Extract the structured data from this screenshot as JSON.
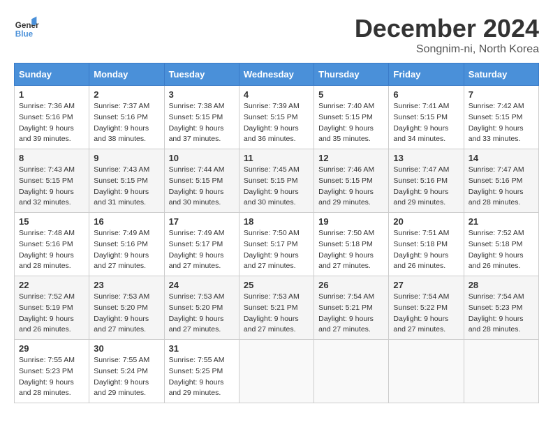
{
  "header": {
    "logo_line1": "General",
    "logo_line2": "Blue",
    "month_title": "December 2024",
    "location": "Songnim-ni, North Korea"
  },
  "weekdays": [
    "Sunday",
    "Monday",
    "Tuesday",
    "Wednesday",
    "Thursday",
    "Friday",
    "Saturday"
  ],
  "weeks": [
    [
      {
        "day": "1",
        "sunrise": "Sunrise: 7:36 AM",
        "sunset": "Sunset: 5:16 PM",
        "daylight": "Daylight: 9 hours and 39 minutes."
      },
      {
        "day": "2",
        "sunrise": "Sunrise: 7:37 AM",
        "sunset": "Sunset: 5:16 PM",
        "daylight": "Daylight: 9 hours and 38 minutes."
      },
      {
        "day": "3",
        "sunrise": "Sunrise: 7:38 AM",
        "sunset": "Sunset: 5:15 PM",
        "daylight": "Daylight: 9 hours and 37 minutes."
      },
      {
        "day": "4",
        "sunrise": "Sunrise: 7:39 AM",
        "sunset": "Sunset: 5:15 PM",
        "daylight": "Daylight: 9 hours and 36 minutes."
      },
      {
        "day": "5",
        "sunrise": "Sunrise: 7:40 AM",
        "sunset": "Sunset: 5:15 PM",
        "daylight": "Daylight: 9 hours and 35 minutes."
      },
      {
        "day": "6",
        "sunrise": "Sunrise: 7:41 AM",
        "sunset": "Sunset: 5:15 PM",
        "daylight": "Daylight: 9 hours and 34 minutes."
      },
      {
        "day": "7",
        "sunrise": "Sunrise: 7:42 AM",
        "sunset": "Sunset: 5:15 PM",
        "daylight": "Daylight: 9 hours and 33 minutes."
      }
    ],
    [
      {
        "day": "8",
        "sunrise": "Sunrise: 7:43 AM",
        "sunset": "Sunset: 5:15 PM",
        "daylight": "Daylight: 9 hours and 32 minutes."
      },
      {
        "day": "9",
        "sunrise": "Sunrise: 7:43 AM",
        "sunset": "Sunset: 5:15 PM",
        "daylight": "Daylight: 9 hours and 31 minutes."
      },
      {
        "day": "10",
        "sunrise": "Sunrise: 7:44 AM",
        "sunset": "Sunset: 5:15 PM",
        "daylight": "Daylight: 9 hours and 30 minutes."
      },
      {
        "day": "11",
        "sunrise": "Sunrise: 7:45 AM",
        "sunset": "Sunset: 5:15 PM",
        "daylight": "Daylight: 9 hours and 30 minutes."
      },
      {
        "day": "12",
        "sunrise": "Sunrise: 7:46 AM",
        "sunset": "Sunset: 5:15 PM",
        "daylight": "Daylight: 9 hours and 29 minutes."
      },
      {
        "day": "13",
        "sunrise": "Sunrise: 7:47 AM",
        "sunset": "Sunset: 5:16 PM",
        "daylight": "Daylight: 9 hours and 29 minutes."
      },
      {
        "day": "14",
        "sunrise": "Sunrise: 7:47 AM",
        "sunset": "Sunset: 5:16 PM",
        "daylight": "Daylight: 9 hours and 28 minutes."
      }
    ],
    [
      {
        "day": "15",
        "sunrise": "Sunrise: 7:48 AM",
        "sunset": "Sunset: 5:16 PM",
        "daylight": "Daylight: 9 hours and 28 minutes."
      },
      {
        "day": "16",
        "sunrise": "Sunrise: 7:49 AM",
        "sunset": "Sunset: 5:16 PM",
        "daylight": "Daylight: 9 hours and 27 minutes."
      },
      {
        "day": "17",
        "sunrise": "Sunrise: 7:49 AM",
        "sunset": "Sunset: 5:17 PM",
        "daylight": "Daylight: 9 hours and 27 minutes."
      },
      {
        "day": "18",
        "sunrise": "Sunrise: 7:50 AM",
        "sunset": "Sunset: 5:17 PM",
        "daylight": "Daylight: 9 hours and 27 minutes."
      },
      {
        "day": "19",
        "sunrise": "Sunrise: 7:50 AM",
        "sunset": "Sunset: 5:18 PM",
        "daylight": "Daylight: 9 hours and 27 minutes."
      },
      {
        "day": "20",
        "sunrise": "Sunrise: 7:51 AM",
        "sunset": "Sunset: 5:18 PM",
        "daylight": "Daylight: 9 hours and 26 minutes."
      },
      {
        "day": "21",
        "sunrise": "Sunrise: 7:52 AM",
        "sunset": "Sunset: 5:18 PM",
        "daylight": "Daylight: 9 hours and 26 minutes."
      }
    ],
    [
      {
        "day": "22",
        "sunrise": "Sunrise: 7:52 AM",
        "sunset": "Sunset: 5:19 PM",
        "daylight": "Daylight: 9 hours and 26 minutes."
      },
      {
        "day": "23",
        "sunrise": "Sunrise: 7:53 AM",
        "sunset": "Sunset: 5:20 PM",
        "daylight": "Daylight: 9 hours and 27 minutes."
      },
      {
        "day": "24",
        "sunrise": "Sunrise: 7:53 AM",
        "sunset": "Sunset: 5:20 PM",
        "daylight": "Daylight: 9 hours and 27 minutes."
      },
      {
        "day": "25",
        "sunrise": "Sunrise: 7:53 AM",
        "sunset": "Sunset: 5:21 PM",
        "daylight": "Daylight: 9 hours and 27 minutes."
      },
      {
        "day": "26",
        "sunrise": "Sunrise: 7:54 AM",
        "sunset": "Sunset: 5:21 PM",
        "daylight": "Daylight: 9 hours and 27 minutes."
      },
      {
        "day": "27",
        "sunrise": "Sunrise: 7:54 AM",
        "sunset": "Sunset: 5:22 PM",
        "daylight": "Daylight: 9 hours and 27 minutes."
      },
      {
        "day": "28",
        "sunrise": "Sunrise: 7:54 AM",
        "sunset": "Sunset: 5:23 PM",
        "daylight": "Daylight: 9 hours and 28 minutes."
      }
    ],
    [
      {
        "day": "29",
        "sunrise": "Sunrise: 7:55 AM",
        "sunset": "Sunset: 5:23 PM",
        "daylight": "Daylight: 9 hours and 28 minutes."
      },
      {
        "day": "30",
        "sunrise": "Sunrise: 7:55 AM",
        "sunset": "Sunset: 5:24 PM",
        "daylight": "Daylight: 9 hours and 29 minutes."
      },
      {
        "day": "31",
        "sunrise": "Sunrise: 7:55 AM",
        "sunset": "Sunset: 5:25 PM",
        "daylight": "Daylight: 9 hours and 29 minutes."
      },
      null,
      null,
      null,
      null
    ]
  ]
}
